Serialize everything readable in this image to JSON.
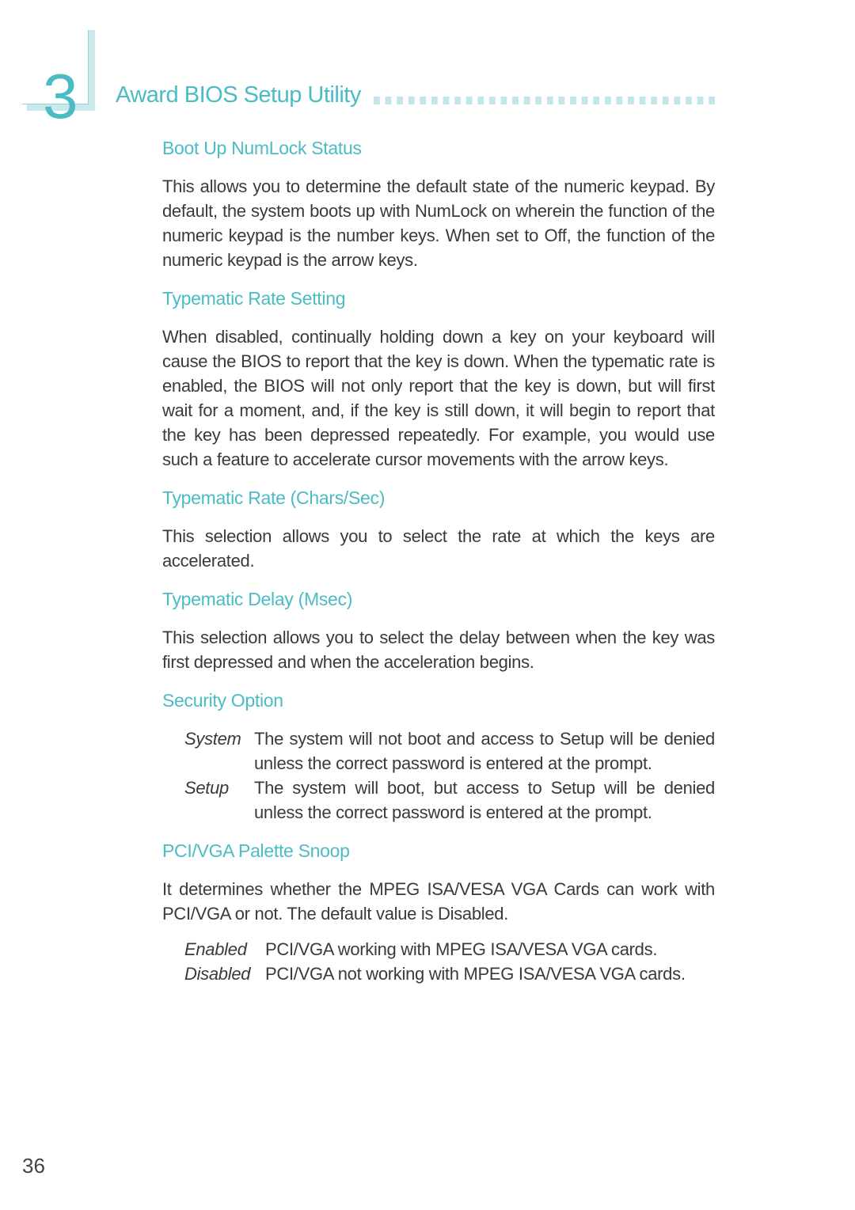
{
  "chapter": {
    "number": "3",
    "title": "Award BIOS Setup Utility"
  },
  "sections": [
    {
      "heading": "Boot Up NumLock Status",
      "body": "This allows you to determine the default state of the numeric keypad. By default, the system boots up with NumLock on wherein the function of the numeric keypad is the number keys. When set to Off, the function of the numeric keypad is the arrow keys."
    },
    {
      "heading": "Typematic Rate Setting",
      "body": "When disabled, continually holding down a key on your keyboard will cause the BIOS to report that the key is down. When the typematic rate is enabled, the BIOS will not only report that the key is down, but will first wait for a moment, and, if the key is still down, it will begin to report that the key has been depressed repeatedly. For example, you would use such a feature to accelerate cursor movements with the arrow keys."
    },
    {
      "heading": "Typematic Rate (Chars/Sec)",
      "body": "This selection allows you to select the rate at which the keys are accelerated."
    },
    {
      "heading": "Typematic Delay (Msec)",
      "body": "This selection allows you to select the delay between when the key was first depressed and when the acceleration begins."
    },
    {
      "heading": "Security Option",
      "options": [
        {
          "key": "System",
          "desc": "The system will not boot and access to Setup will be denied unless the correct password is entered at the prompt."
        },
        {
          "key": "Setup",
          "desc": "The system will boot, but access to Setup will be denied unless the correct password is entered at the prompt."
        }
      ]
    },
    {
      "heading": "PCI/VGA Palette Snoop",
      "body": "It determines whether the MPEG ISA/VESA VGA Cards can work with PCI/VGA or not. The default value is Disabled.",
      "options": [
        {
          "key": "Enabled",
          "desc": "PCI/VGA working with MPEG ISA/VESA VGA cards."
        },
        {
          "key": "Disabled",
          "desc": "PCI/VGA not working with MPEG ISA/VESA VGA cards."
        }
      ]
    }
  ],
  "page_number": "36"
}
